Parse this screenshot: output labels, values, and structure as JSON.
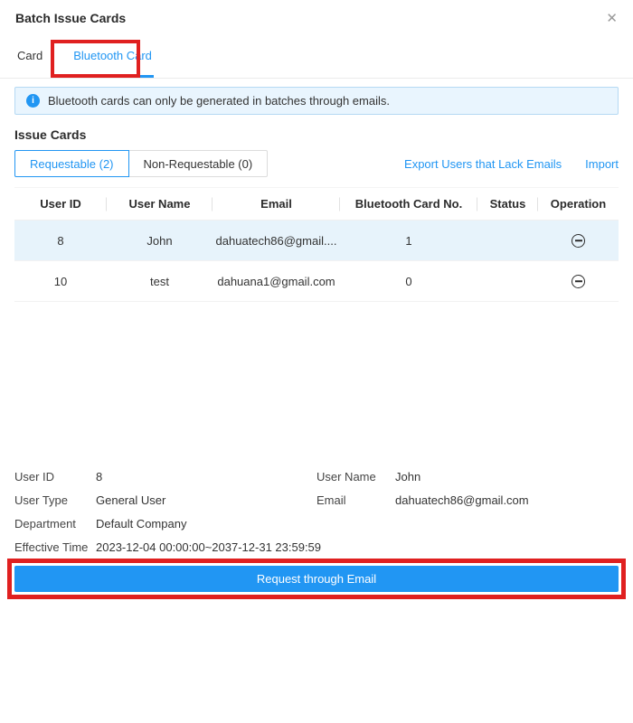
{
  "dialog": {
    "title": "Batch Issue Cards",
    "close_icon": "✕"
  },
  "tabs": [
    {
      "label": "Card",
      "active": false
    },
    {
      "label": "Bluetooth Card",
      "active": true
    }
  ],
  "banner": {
    "icon": "i",
    "text": "Bluetooth cards can only be generated in batches through emails."
  },
  "section": {
    "title": "Issue Cards"
  },
  "filters": [
    {
      "label": "Requestable (2)",
      "active": true
    },
    {
      "label": "Non-Requestable (0)",
      "active": false
    }
  ],
  "links": {
    "export": "Export Users that Lack Emails",
    "import": "Import"
  },
  "table": {
    "columns": [
      "User ID",
      "User Name",
      "Email",
      "Bluetooth Card No.",
      "Status",
      "Operation"
    ],
    "operation_icon": "circle-minus",
    "rows": [
      {
        "user_id": "8",
        "user_name": "John",
        "email": "dahuatech86@gmail....",
        "card_no": "1",
        "status": "",
        "selected": true
      },
      {
        "user_id": "10",
        "user_name": "test",
        "email": "dahuana1@gmail.com",
        "card_no": "0",
        "status": "",
        "selected": false
      }
    ]
  },
  "details": {
    "rows": [
      {
        "left_label": "User ID",
        "left_value": "8",
        "right_label": "User Name",
        "right_value": "John"
      },
      {
        "left_label": "User Type",
        "left_value": "General User",
        "right_label": "Email",
        "right_value": "dahuatech86@gmail.com"
      },
      {
        "left_label": "Department",
        "left_value": "Default Company",
        "right_label": "",
        "right_value": ""
      },
      {
        "left_label": "Effective Time",
        "left_value": "2023-12-04 00:00:00~2037-12-31 23:59:59",
        "right_label": "",
        "right_value": ""
      }
    ]
  },
  "footer": {
    "request_button": "Request through Email"
  },
  "colors": {
    "accent": "#2196f3",
    "annotation_red": "#e02020",
    "banner_bg": "#e9f5fe",
    "banner_border": "#b5d9f3",
    "selected_row": "#e7f3fb"
  }
}
